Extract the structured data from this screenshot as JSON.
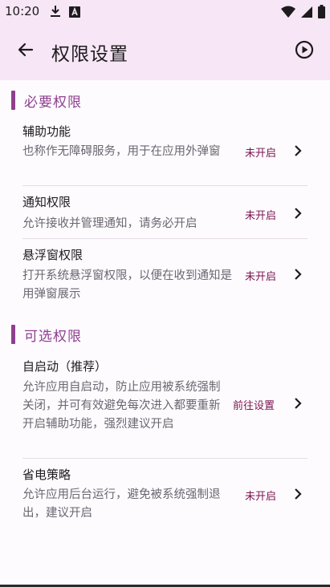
{
  "status_bar": {
    "time": "10:20",
    "left_icons": [
      "download-icon",
      "text-a-icon"
    ],
    "right_icons": [
      "wifi-icon",
      "signal-icon",
      "battery-icon"
    ]
  },
  "app_bar": {
    "title": "权限设置",
    "back_icon": "arrow-back-icon",
    "action_icon": "play-circle-icon"
  },
  "sections": [
    {
      "title": "必要权限",
      "items": [
        {
          "title": "辅助功能",
          "description": "也称作无障碍服务，用于在应用外弹窗",
          "status": "未开启"
        },
        {
          "title": "通知权限",
          "description": "允许接收并管理通知，请务必开启",
          "status": "未开启"
        },
        {
          "title": "悬浮窗权限",
          "description": "打开系统悬浮窗权限，以便在收到通知是用弹窗展示",
          "status": "未开启"
        }
      ]
    },
    {
      "title": "可选权限",
      "items": [
        {
          "title": "自启动（推荐）",
          "description": "允许应用自启动，防止应用被系统强制关闭，并可有效避免每次进入都要重新开启辅助功能，强烈建议开启",
          "status": "前往设置"
        },
        {
          "title": "省电策略",
          "description": "允许应用后台运行，避免被系统强制退出，建议开启",
          "status": "未开启"
        }
      ]
    }
  ],
  "colors": {
    "accent": "#8e3f8e",
    "status_text": "#7a1550",
    "app_bar_bg": "#f7e6f5",
    "page_bg": "#fefbff"
  }
}
